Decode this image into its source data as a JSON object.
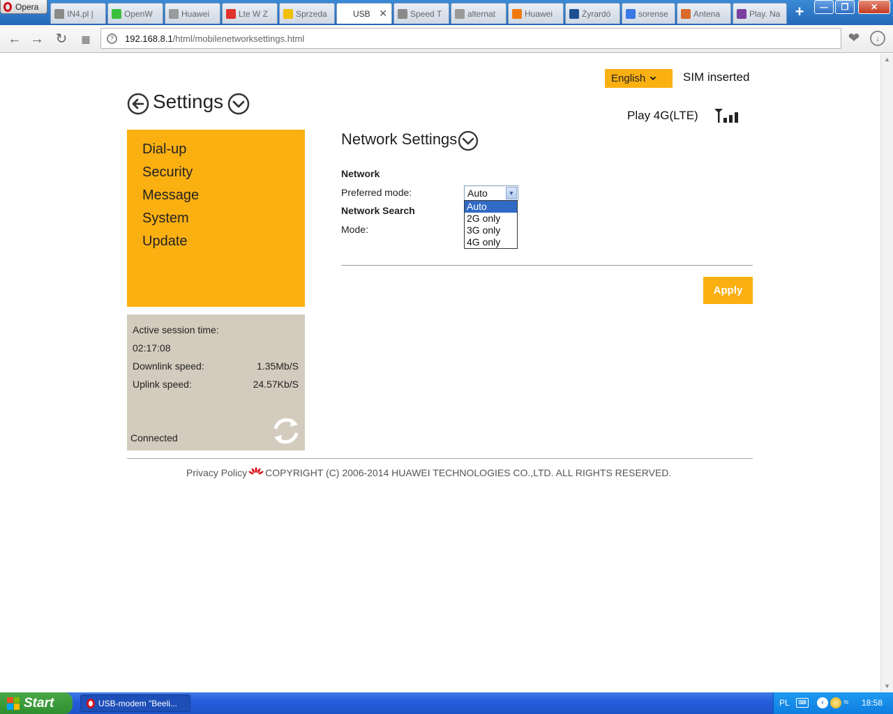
{
  "browser": {
    "menu_label": "Opera",
    "tabs": [
      {
        "label": "IN4.pl |",
        "color": "#8a8a8a"
      },
      {
        "label": "OpenW",
        "color": "#3cbf3c"
      },
      {
        "label": "Huawei",
        "color": "#9a9a9a"
      },
      {
        "label": "Lte W Z",
        "color": "#e0322b"
      },
      {
        "label": "Sprzeda",
        "color": "#f0c000"
      },
      {
        "label": "USB",
        "color": "#ffffff"
      },
      {
        "label": "Speed T",
        "color": "#8a8a8a"
      },
      {
        "label": "alternat",
        "color": "#9a9a9a"
      },
      {
        "label": "Huawei",
        "color": "#f07a10"
      },
      {
        "label": "Żyrardó",
        "color": "#1d4f91"
      },
      {
        "label": "sorense",
        "color": "#3b78e7"
      },
      {
        "label": "Antena",
        "color": "#d86a2a"
      },
      {
        "label": "Play. Na",
        "color": "#7a3fa0"
      }
    ],
    "active_tab_index": 5,
    "url_host": "192.168.8.1",
    "url_path": "/html/mobilenetworksettings.html"
  },
  "header": {
    "language": "English",
    "sim_status": "SIM inserted",
    "operator": "Play 4G(LTE)",
    "signal_bars": 3
  },
  "page": {
    "title": "Settings"
  },
  "sidebar": {
    "items": [
      {
        "label": "Dial-up",
        "active": true
      },
      {
        "label": "Security",
        "active": false
      },
      {
        "label": "Message",
        "active": false
      },
      {
        "label": "System",
        "active": false
      },
      {
        "label": "Update",
        "active": false
      }
    ]
  },
  "status": {
    "session_label": "Active session time:",
    "session_time": "02:17:08",
    "downlink_label": "Downlink speed:",
    "downlink_value": "1.35Mb/S",
    "uplink_label": "Uplink speed:",
    "uplink_value": "24.57Kb/S",
    "connection": "Connected"
  },
  "network_settings": {
    "title": "Network Settings",
    "network_heading": "Network",
    "preferred_mode_label": "Preferred mode:",
    "preferred_mode_value": "Auto",
    "preferred_mode_options": [
      "Auto",
      "2G only",
      "3G only",
      "4G only"
    ],
    "highlighted_option": "Auto",
    "search_heading": "Network Search",
    "mode_label": "Mode:",
    "apply_label": "Apply"
  },
  "footer": {
    "privacy_label": "Privacy Policy",
    "copyright": "COPYRIGHT (C) 2006-2014 HUAWEI TECHNOLOGIES CO.,LTD. ALL RIGHTS RESERVED."
  },
  "taskbar": {
    "start_label": "Start",
    "task_label": "USB-modem \"Beeli...",
    "lang": "PL",
    "clock": "18:58"
  },
  "colors": {
    "accent": "#fbb012",
    "status_panel": "#d3cbbd",
    "select_highlight": "#316ac5"
  }
}
